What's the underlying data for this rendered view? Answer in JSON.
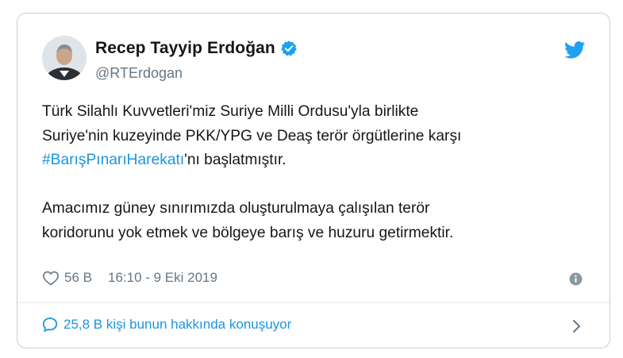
{
  "tweet": {
    "author_name": "Recep Tayyip Erdoğan",
    "handle": "@RTErdogan",
    "text_p1_line1": "Türk Silahlı Kuvvetleri'miz Suriye Milli Ordusu'yla birlikte",
    "text_p1_line2": "Suriye'nin kuzeyinde PKK/YPG ve Deaş terör örgütlerine karşı",
    "hashtag": "#BarışPınarıHarekatı",
    "text_p1_line3_rest": "'nı başlatmıştır.",
    "text_p2_line1": "Amacımız güney sınırımızda oluşturulmaya çalışılan terör",
    "text_p2_line2": "koridorunu yok etmek ve bölgeye barış ve huzuru getirmektir.",
    "likes": "56 B",
    "timestamp": "16:10 - 9 Eki 2019",
    "conversation": "25,8 B kişi bunun hakkında konuşuyor"
  },
  "icons": {
    "verified": "verified-badge-icon",
    "brand": "twitter-bird-icon",
    "like": "heart-icon",
    "info": "info-icon",
    "reply": "speech-bubble-icon",
    "chevron": "chevron-right-icon"
  },
  "colors": {
    "brand_blue": "#1da1f2",
    "link_blue": "#1b95e0",
    "muted": "#657786",
    "text": "#14171a",
    "border": "#c4cfd6"
  }
}
